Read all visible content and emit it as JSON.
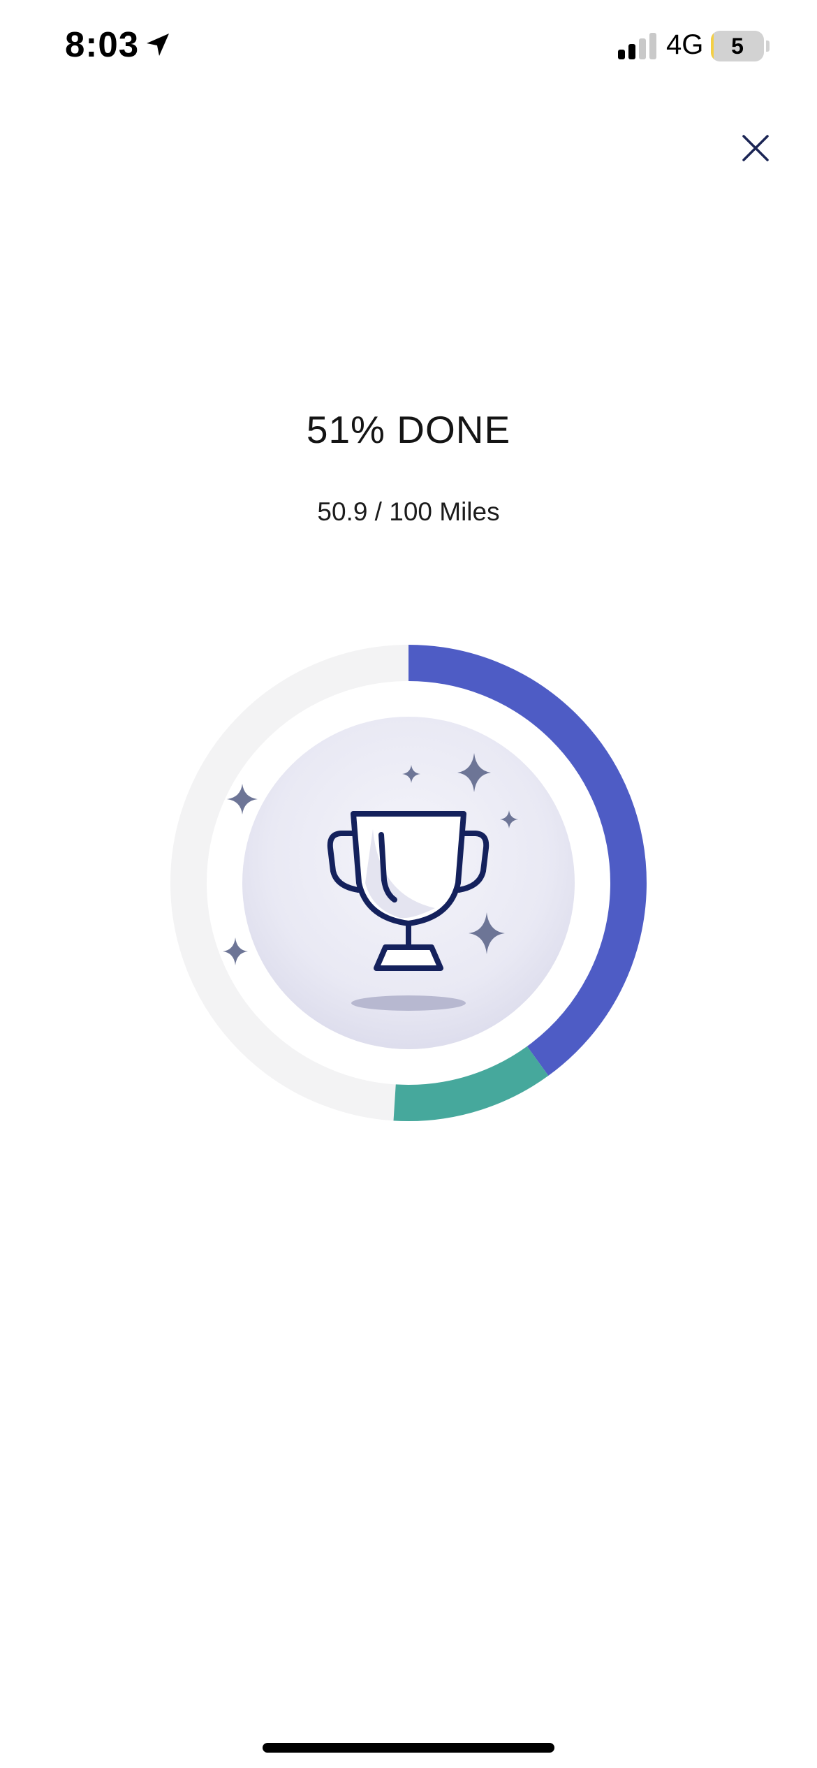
{
  "status_bar": {
    "time": "8:03",
    "network": "4G",
    "battery_level": "5",
    "battery_fraction": 0.05,
    "icons": [
      "location-arrow-icon",
      "signal-bars-icon",
      "battery-icon"
    ]
  },
  "header": {
    "close_icon": "close-icon"
  },
  "progress": {
    "title": "51% DONE",
    "subtitle": "50.9 / 100 Miles",
    "completed_fraction": 0.4,
    "recent_fraction": 0.11,
    "colors": {
      "completed": "#4e5cc5",
      "recent": "#46a89c",
      "track": "#f3f3f4",
      "inner_circle": "#e8e8f3"
    }
  },
  "badge": {
    "icon": "trophy-icon",
    "decorations": "sparkle-icon",
    "colors": {
      "trophy_stroke": "#14215c",
      "sparkle": "#6d7596",
      "shadow": "#b7b8d0"
    }
  }
}
